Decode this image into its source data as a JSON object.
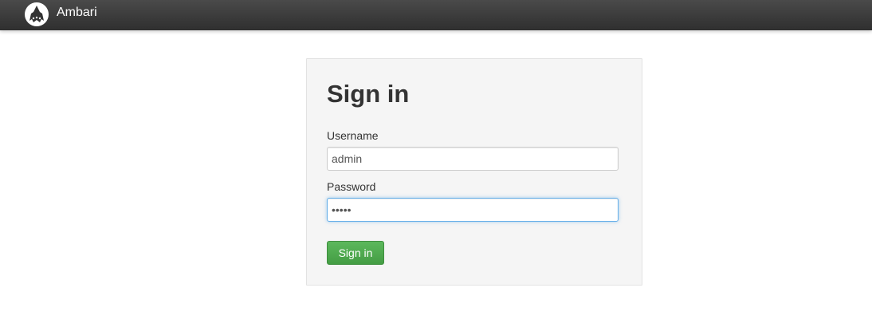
{
  "navbar": {
    "brand": "Ambari",
    "logo_icon": "ambari-elephant-logo"
  },
  "login": {
    "title": "Sign in",
    "username_label": "Username",
    "username_value": "admin",
    "password_label": "Password",
    "password_value": "admin",
    "submit_label": "Sign in"
  },
  "colors": {
    "navbar_bg": "#3a3a3a",
    "panel_bg": "#f5f5f5",
    "button_green": "#5cb85c",
    "focus_blue": "#66afe9"
  }
}
